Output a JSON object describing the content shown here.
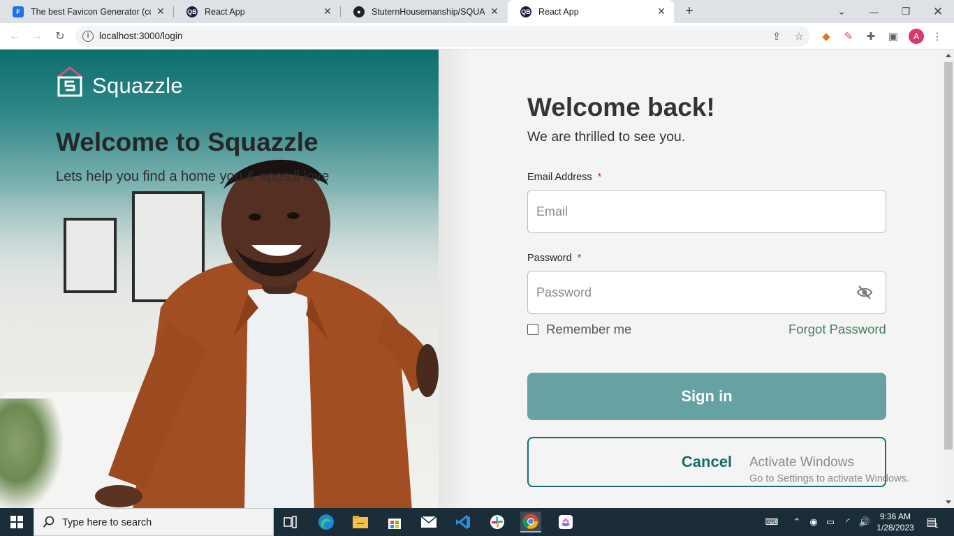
{
  "browser": {
    "tabs": [
      {
        "title": "The best Favicon Generator (com",
        "favicon": "favicon-generator-icon",
        "color": "#1a73e8"
      },
      {
        "title": "React App",
        "favicon": "react-app-icon",
        "color": "#1b1f3b"
      },
      {
        "title": "StuternHousemanship/SQUAZZL",
        "favicon": "github-icon",
        "color": "#202124"
      },
      {
        "title": "React App",
        "favicon": "react-app-icon",
        "color": "#1b1f3b"
      }
    ],
    "active_tab": 3,
    "url": "localhost:3000/login",
    "profile_initial": "A"
  },
  "hero": {
    "brand": "Squazzle",
    "title": "Welcome to Squazzle",
    "subtitle": "Lets help you find a home you & apos;ll love"
  },
  "form": {
    "title": "Welcome back!",
    "subtitle": "We are thrilled to see you.",
    "email_label": "Email Address",
    "email_placeholder": "Email",
    "password_label": "Password",
    "password_placeholder": "Password",
    "required_mark": "*",
    "remember_label": "Remember me",
    "forgot_label": "Forgot Password",
    "signin_label": "Sign in",
    "cancel_label": "Cancel"
  },
  "watermark": {
    "line1": "Activate Windows",
    "line2": "Go to Settings to activate Windows."
  },
  "taskbar": {
    "search_placeholder": "Type here to search",
    "time": "9:36 AM",
    "date": "1/28/2023",
    "notification_count": "1"
  },
  "colors": {
    "accent": "#166c6c",
    "signin_bg": "#66a2a4",
    "forgot_link": "#4b7d5e",
    "required": "#b02a2a"
  }
}
